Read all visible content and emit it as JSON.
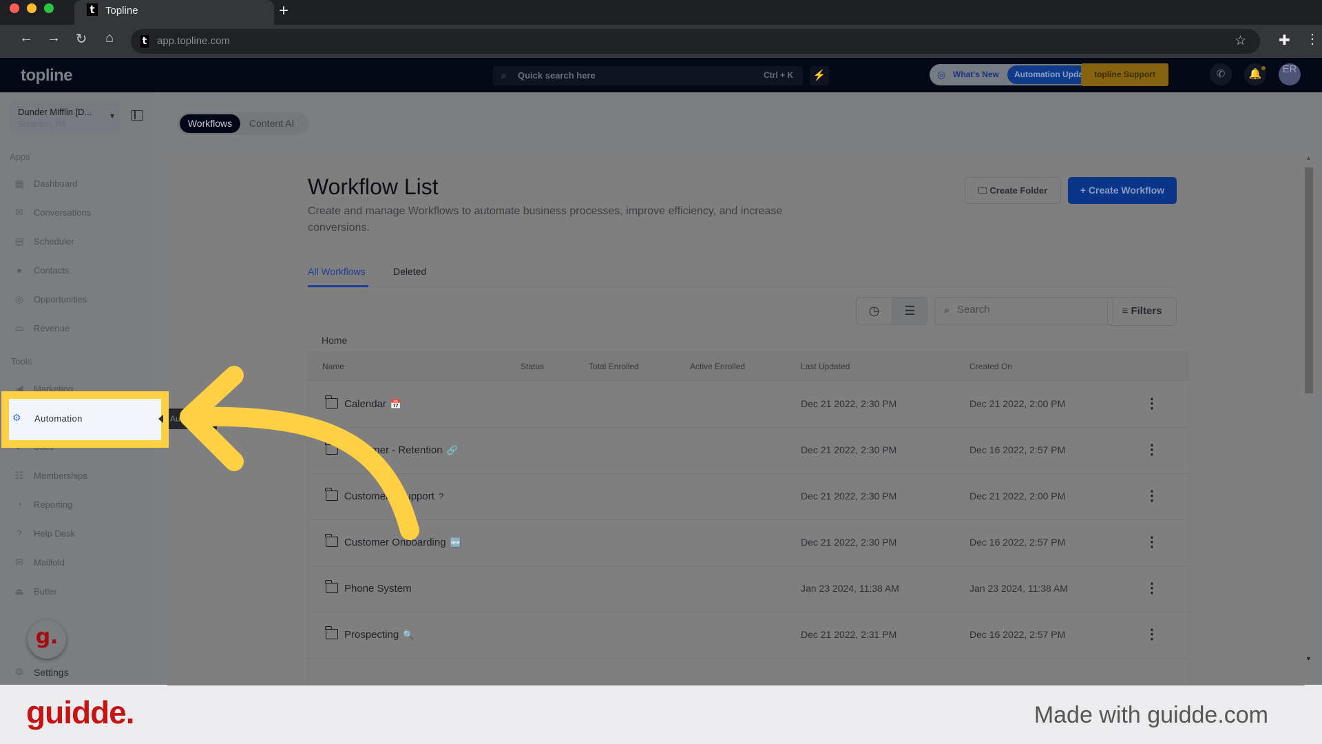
{
  "browser": {
    "tab_title": "Topline",
    "favicon": "t",
    "new_tab": "+",
    "url": "app.topline.com",
    "nav": {
      "back": "←",
      "forward": "→",
      "reload": "↻",
      "home": "⌂"
    },
    "icons": {
      "star": "☆",
      "extensions": "✚",
      "menu": "⋮"
    }
  },
  "header": {
    "logo": "topline",
    "quick_search": {
      "placeholder": "Quick search here",
      "shortcut": "Ctrl + K",
      "icon": "⌕"
    },
    "bolt_icon": "⚡",
    "whats_new": {
      "label": "What's New",
      "pill": "Automation Updates"
    },
    "support": "topline Support",
    "phone_icon": "✆",
    "bell_icon": "🔔",
    "avatar": "ER"
  },
  "sidebar": {
    "location": {
      "name": "Dunder Mifflin [D...",
      "sub": "Scranton, PA"
    },
    "apps_label": "Apps",
    "apps": [
      {
        "label": "Dashboard",
        "icon": "▦"
      },
      {
        "label": "Conversations",
        "icon": "✉"
      },
      {
        "label": "Scheduler",
        "icon": "▤"
      },
      {
        "label": "Contacts",
        "icon": "●"
      },
      {
        "label": "Opportunities",
        "icon": "◎"
      },
      {
        "label": "Revenue",
        "icon": "▭"
      }
    ],
    "tools_label": "Tools",
    "tools": [
      {
        "label": "Marketing",
        "icon": "◀"
      },
      {
        "label": "Automation",
        "icon": "⚙"
      },
      {
        "label": "Sites",
        "icon": "➶"
      },
      {
        "label": "Memberships",
        "icon": "☷"
      },
      {
        "label": "Reporting",
        "icon": "◔"
      },
      {
        "label": "Help Desk",
        "icon": "?"
      },
      {
        "label": "Mailfold",
        "icon": "✉"
      },
      {
        "label": "Butler",
        "icon": "⏏"
      }
    ],
    "settings": {
      "label": "Settings",
      "icon": "⚙"
    },
    "tooltip": "Automation",
    "highlighted": "Automation"
  },
  "main": {
    "switch": {
      "workflows": "Workflows",
      "content_ai": "Content AI"
    },
    "title": "Workflow List",
    "description": "Create and manage Workflows to automate business processes, improve efficiency, and increase conversions.",
    "buttons": {
      "create_folder": "Create Folder",
      "create_workflow": "Create Workflow",
      "folder_icon": "🗀",
      "plus_icon": "+"
    },
    "tabs": {
      "all": "All Workflows",
      "deleted": "Deleted"
    },
    "toolbar": {
      "clock_icon": "◷",
      "list_icon": "☰",
      "search_placeholder": "Search",
      "search_icon": "⌕",
      "filters": "Filters",
      "filters_icon": "≡"
    },
    "breadcrumb": "Home",
    "table": {
      "columns": [
        "Name",
        "Status",
        "Total Enrolled",
        "Active Enrolled",
        "Last Updated",
        "Created On"
      ],
      "rows": [
        {
          "name": "Calendar",
          "emoji": "📅",
          "status": "",
          "total": "",
          "active": "",
          "updated": "Dec 21 2022, 2:30 PM",
          "created": "Dec 21 2022, 2:00 PM"
        },
        {
          "name": "Customer - Retention",
          "emoji": "🔗",
          "status": "",
          "total": "",
          "active": "",
          "updated": "Dec 21 2022, 2:30 PM",
          "created": "Dec 16 2022, 2:57 PM"
        },
        {
          "name": "Customer - Support",
          "emoji": "?",
          "status": "",
          "total": "",
          "active": "",
          "updated": "Dec 21 2022, 2:30 PM",
          "created": "Dec 21 2022, 2:00 PM"
        },
        {
          "name": "Customer Onboarding",
          "emoji": "🆕",
          "status": "",
          "total": "",
          "active": "",
          "updated": "Dec 21 2022, 2:30 PM",
          "created": "Dec 16 2022, 2:57 PM"
        },
        {
          "name": "Phone System",
          "emoji": "",
          "status": "",
          "total": "",
          "active": "",
          "updated": "Jan 23 2024, 11:38 AM",
          "created": "Jan 23 2024, 11:38 AM"
        },
        {
          "name": "Prospecting",
          "emoji": "🔍",
          "status": "",
          "total": "",
          "active": "",
          "updated": "Dec 21 2022, 2:31 PM",
          "created": "Dec 16 2022, 2:57 PM"
        }
      ],
      "row_menu_icon": "⋮"
    },
    "scroll": {
      "up": "▲",
      "down": "▼"
    }
  },
  "guidde": {
    "fab": "g.",
    "footer_logo": "guidde.",
    "footer_text": "Made with guidde.com",
    "accent": "#ffd044",
    "brand": "#c41414"
  }
}
